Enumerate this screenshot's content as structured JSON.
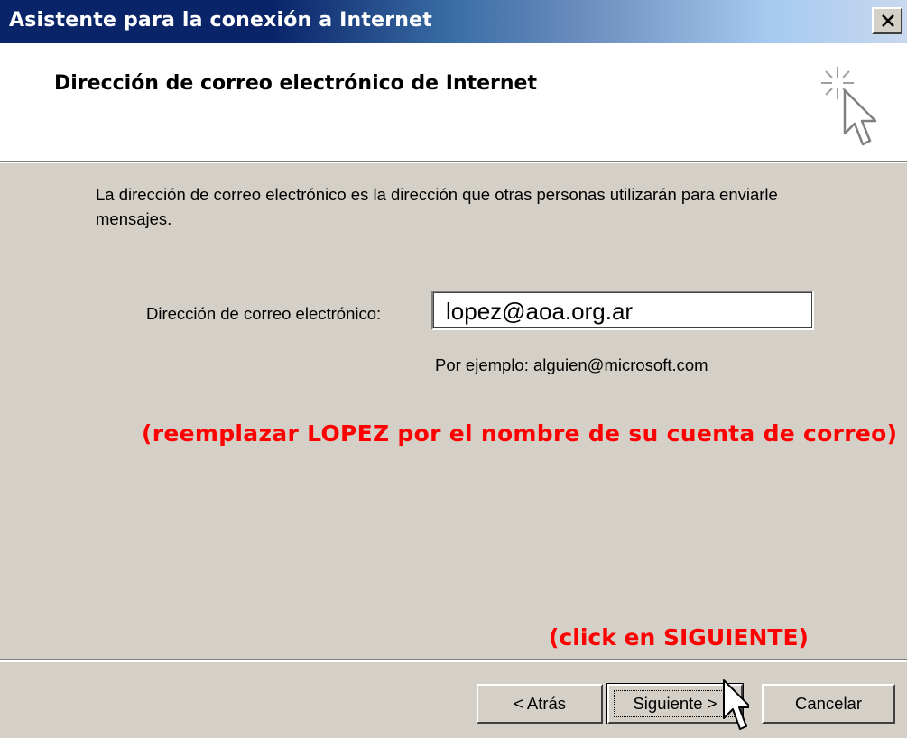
{
  "window": {
    "title": "Asistente para la conexión a Internet",
    "close_glyph": "×"
  },
  "header": {
    "heading": "Dirección de correo electrónico de Internet",
    "icon": "wizard-sparkle-cursor-icon"
  },
  "body": {
    "intro": "La dirección de correo electrónico es la dirección que otras personas utilizarán para enviarle mensajes.",
    "email_label": "Dirección de correo electrónico:",
    "email_value": "lopez@aoa.org.ar",
    "example": "Por ejemplo: alguien@microsoft.com",
    "note_account": "(reemplazar LOPEZ por el nombre de su cuenta de correo)",
    "note_next": "(click en SIGUIENTE)"
  },
  "buttons": {
    "back": "< Atrás",
    "next": "Siguiente >",
    "cancel": "Cancelar"
  },
  "colors": {
    "titlebar_dark": "#0a246a",
    "dialog_face": "#d4d0c8",
    "annotation_red": "#ff0000"
  }
}
